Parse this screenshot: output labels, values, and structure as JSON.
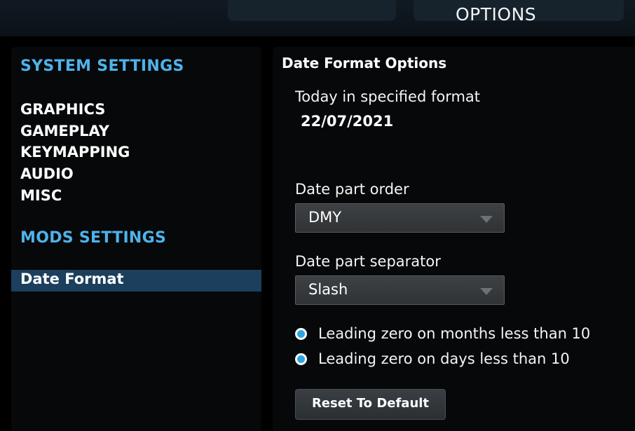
{
  "header": {
    "title": "OPTIONS"
  },
  "sidebar": {
    "system_heading": "SYSTEM SETTINGS",
    "system_items": [
      "GRAPHICS",
      "GAMEPLAY",
      "KEYMAPPING",
      "AUDIO",
      "MISC"
    ],
    "mods_heading": "MODS SETTINGS",
    "mods_items": [
      "Date Format"
    ],
    "selected": "Date Format"
  },
  "panel": {
    "title": "Date Format Options",
    "today_label": "Today in specified format",
    "today_value": "22/07/2021",
    "order_label": "Date part order",
    "order_value": "DMY",
    "separator_label": "Date part separator",
    "separator_value": "Slash",
    "leading_zero_months": "Leading zero on months less than 10",
    "leading_zero_days": "Leading zero on days less than 10",
    "reset_button": "Reset To Default"
  },
  "colors": {
    "accent": "#4fb2ea",
    "selected_bg": "#1b3f5c",
    "radio": "#2ea4e0"
  }
}
